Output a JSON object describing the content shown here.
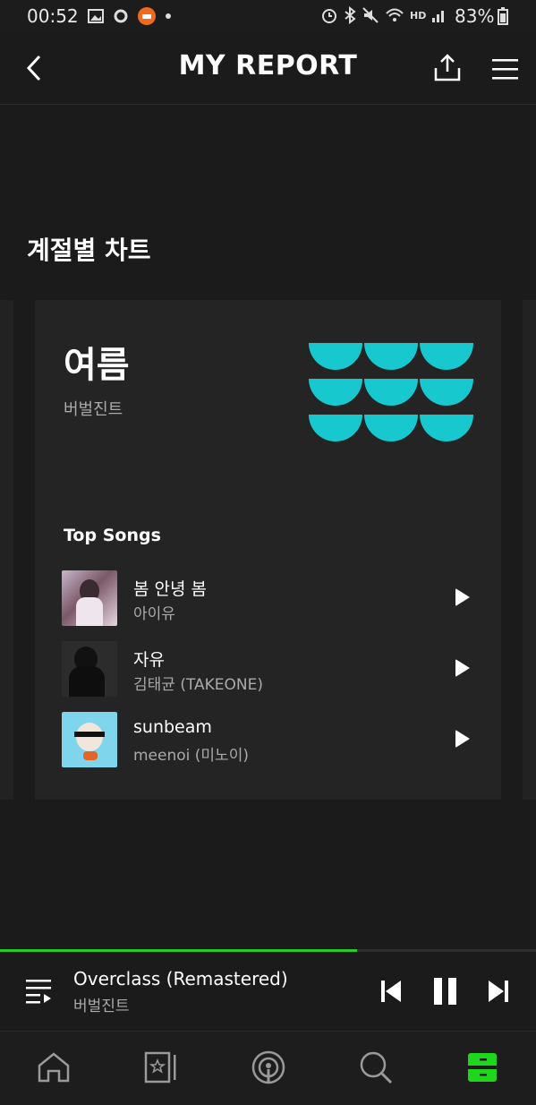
{
  "status_bar": {
    "time": "00:52",
    "battery": "83%",
    "network_label": "HD"
  },
  "header": {
    "title": "MY REPORT"
  },
  "section": {
    "title": "계절별 차트"
  },
  "card": {
    "season": "여름",
    "artist": "버벌진트",
    "top_songs_label": "Top Songs",
    "songs": [
      {
        "title": "봄 안녕 봄",
        "artist": "아이유"
      },
      {
        "title": "자유",
        "artist": "김태균 (TAKEONE)"
      },
      {
        "title": "sunbeam",
        "artist": "meenoi (미노이)"
      }
    ],
    "accent_color": "#17c9cf"
  },
  "player": {
    "title": "Overclass (Remastered)",
    "artist": "버벌진트",
    "progress": 0.666,
    "progress_color": "#29c82c"
  },
  "bottom_nav": {
    "items": [
      "home-icon",
      "library-icon",
      "podcast-icon",
      "search-icon",
      "my-icon"
    ],
    "active": "my-icon"
  }
}
